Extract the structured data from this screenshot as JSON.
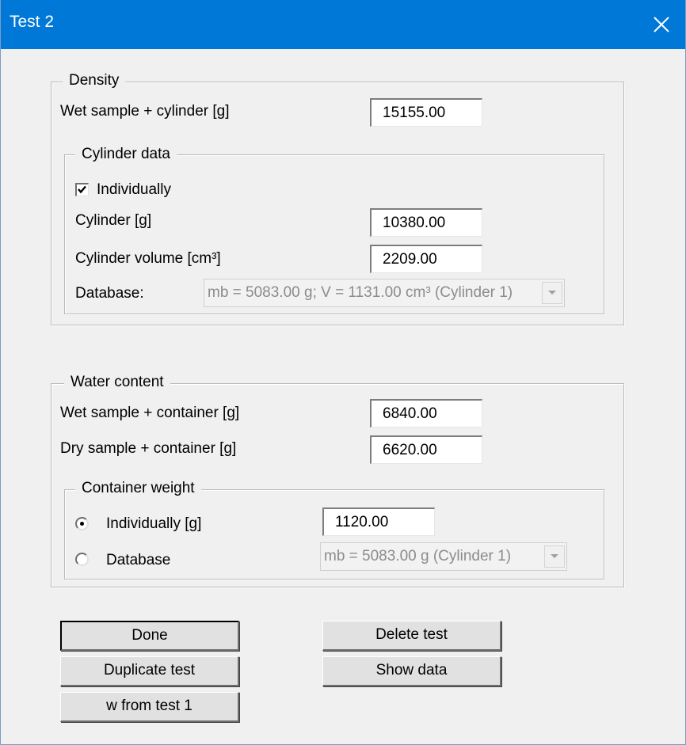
{
  "window": {
    "title": "Test 2",
    "close_icon": "close-icon"
  },
  "density": {
    "legend": "Density",
    "wet_sample_label": "Wet sample + cylinder [g]",
    "wet_sample_value": "15155.00",
    "cylinder_data": {
      "legend": "Cylinder data",
      "individually_label": "Individually",
      "individually_checked": true,
      "cylinder_label": "Cylinder [g]",
      "cylinder_value": "10380.00",
      "volume_label": "Cylinder volume [cm³]",
      "volume_value": "2209.00",
      "database_label": "Database:",
      "database_value": "mb = 5083.00 g; V = 1131.00 cm³ (Cylinder 1)"
    }
  },
  "water_content": {
    "legend": "Water content",
    "wet_label": "Wet sample + container [g]",
    "wet_value": "6840.00",
    "dry_label": "Dry sample + container [g]",
    "dry_value": "6620.00",
    "container_weight": {
      "legend": "Container weight",
      "individually_label": "Individually [g]",
      "individually_value": "1120.00",
      "database_label": "Database",
      "database_value": "mb = 5083.00 g (Cylinder 1)",
      "selected": "individually"
    }
  },
  "buttons": {
    "done": "Done",
    "delete_test": "Delete test",
    "duplicate_test": "Duplicate test",
    "show_data": "Show data",
    "w_from_test": "w from test 1"
  }
}
